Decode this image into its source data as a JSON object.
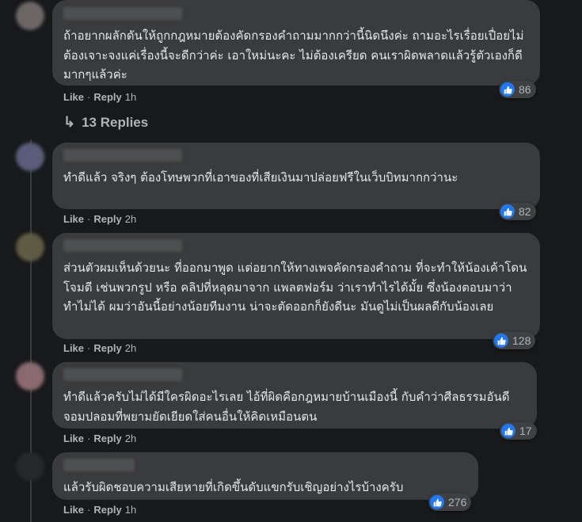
{
  "comments": [
    {
      "text": "ถ้าอยากผลักดันให้ถูกกฎหมายต้องคัดกรองคำถามมากกว่านี้นิดนึงค่ะ ถามอะไรเรื่อยเปื่อยไม่ต้องเจาะจงแค่เรื่องนี้จะดีกว่าค่ะ เอาใหม่นะคะ ไม่ต้องเครียด คนเราผิดพลาดแล้วรู้ตัวเองก็ดีมากๆแล้วค่ะ",
      "like": "Like",
      "reply": "Reply",
      "time": "1h",
      "reactions": "86"
    },
    {
      "text": "ทำดีแล้ว จริงๆ ต้องโทษพวกที่เอาของที่เสียเงินมาปล่อยฟรีในเว็บบิทมากกว่านะ",
      "like": "Like",
      "reply": "Reply",
      "time": "2h",
      "reactions": "82"
    },
    {
      "text": "ส่วนตัวผมเห็นด้วยนะ ที่ออกมาพูด แต่อยากให้ทางเพจคัดกรองคำถาม ที่จะทำให้น้องเค้าโดนโจมตี เช่นพวกรูป หรือ คลิปที่หลุดมาจาก แพลตฟอร์ม ว่าเราทำไรได้มั้ย ซึ่งน้องตอบมาว่า ทำไม่ได้ ผมว่าอันนี้อย่างน้อยทีมงาน น่าจะตัดออกก็ยังดีนะ มันดูไม่เป็นผลดีกับน้องเลย",
      "like": "Like",
      "reply": "Reply",
      "time": "2h",
      "reactions": "128"
    },
    {
      "text": "ทำดีแล้วครับไม่ได้มีใครผิดอะไรเลย ไอ้ที่ผิดคือกฎหมายบ้านเมืองนี้ กับคำว่าศีลธรรมอันดีจอมปลอมที่พยามยัดเยียดใส่คนอื่นให้คิดเหมือนตน",
      "like": "Like",
      "reply": "Reply",
      "time": "2h",
      "reactions": "17"
    },
    {
      "text": "แล้วรับผิดชอบความเสียหายที่เกิดขึ้นดับแขกรับเชิญอย่างไรบ้างครับ",
      "like": "Like",
      "reply": "Reply",
      "time": "1h",
      "reactions": "276"
    }
  ],
  "replies_link": "13 Replies",
  "colors": {
    "background": "#18191a",
    "bubble": "#3a3b3c",
    "text": "#e4e6eb",
    "secondary_text": "#b0b3b8",
    "like_blue": "#2078f4"
  },
  "icons": {
    "like": "thumbs-up-icon",
    "reply_arrow": "reply-arrow-icon"
  }
}
